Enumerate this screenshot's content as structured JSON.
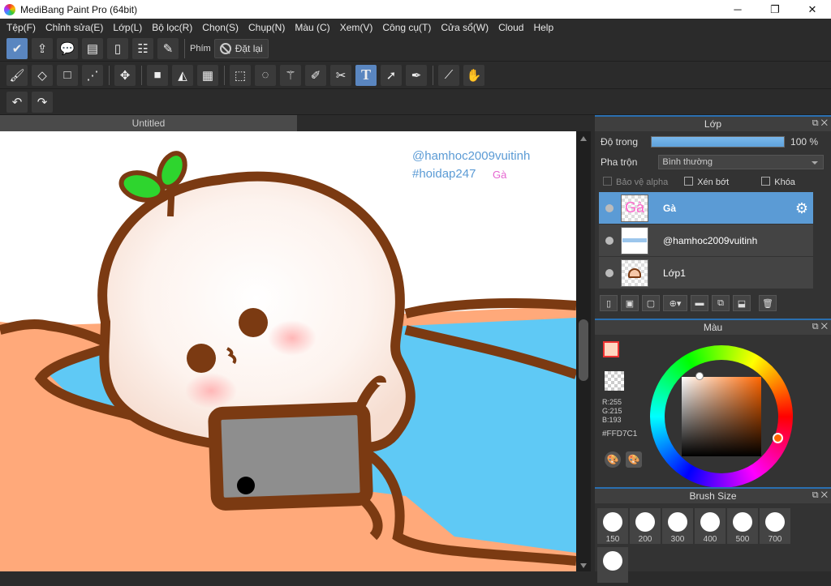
{
  "window": {
    "title": "MediBang Paint Pro (64bit)",
    "minimize": "─",
    "maximize": "❐",
    "close": "✕"
  },
  "menu": [
    "Tệp(F)",
    "Chỉnh sửa(E)",
    "Lớp(L)",
    "Bộ lọc(R)",
    "Chọn(S)",
    "Chụp(N)",
    "Màu (C)",
    "Xem(V)",
    "Công cụ(T)",
    "Cửa sổ(W)",
    "Cloud",
    "Help"
  ],
  "toolbar": {
    "phim_label": "Phím",
    "reset_label": "Đặt lại"
  },
  "document": {
    "tab": "Untitled"
  },
  "canvas": {
    "text1": "@hamhoc2009vuitinh",
    "text2": "#hoidap247",
    "text3": "Gà"
  },
  "layers_panel": {
    "title": "Lớp",
    "opacity_label": "Độ trong",
    "opacity_value": "100 %",
    "blend_label": "Pha trộn",
    "blend_value": "Bình thường",
    "protect_alpha": "Bảo vệ alpha",
    "clip": "Xén bớt",
    "lock": "Khóa",
    "layers": [
      {
        "name": "Gà",
        "thumb": "Gà",
        "selected": true
      },
      {
        "name": "@hamhoc2009vuitinh",
        "thumb": "",
        "selected": false
      },
      {
        "name": "Lớp1",
        "thumb": "",
        "selected": false
      }
    ]
  },
  "color_panel": {
    "title": "Màu",
    "r": "R:255",
    "g": "G:215",
    "b": "B:193",
    "hex": "#FFD7C1",
    "primary_color": "#FFD7C1"
  },
  "brush_panel": {
    "title": "Brush Size",
    "sizes": [
      "150",
      "200",
      "300",
      "400",
      "500",
      "700"
    ]
  }
}
